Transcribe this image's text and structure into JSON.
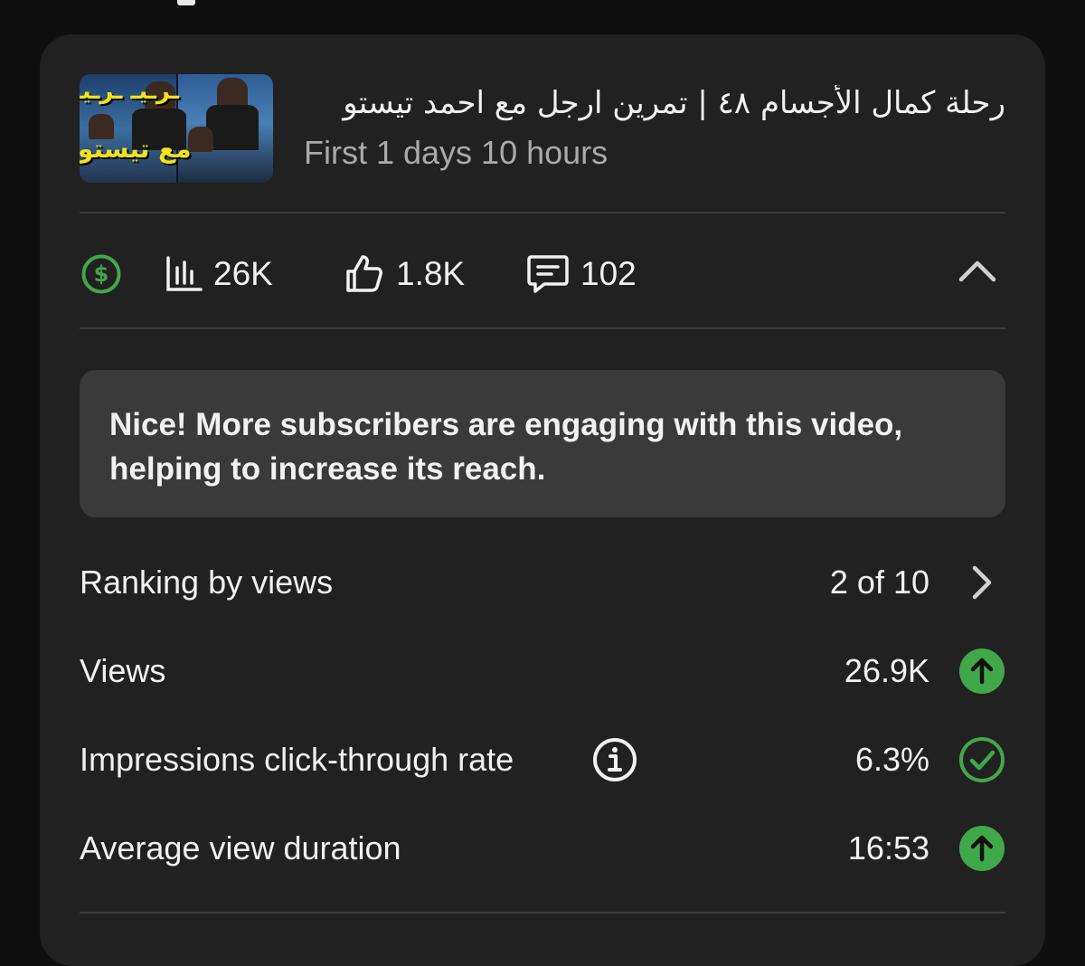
{
  "video": {
    "title": "رحلة كمال الأجسام ٤٨ | تمرين ارجل مع احمد تيستو",
    "subtitle": "First 1 days 10 hours",
    "thumbnail_text_top": "مع تيستو",
    "thumbnail_text_bottom": "مع تيستو"
  },
  "stats": {
    "monetization_icon": "dollar-circle-icon",
    "views": "26K",
    "likes": "1.8K",
    "comments": "102",
    "collapse_icon": "chevron-up-icon"
  },
  "tip": {
    "text": "Nice! More subscribers are engaging with this video, helping to increase its reach."
  },
  "metrics": [
    {
      "label": "Ranking by views",
      "value": "2 of 10",
      "indicator": "chevron-right-icon"
    },
    {
      "label": "Views",
      "value": "26.9K",
      "indicator": "arrow-up-icon"
    },
    {
      "label": "Impressions click-through rate",
      "value": "6.3%",
      "indicator": "check-circle-icon",
      "info_icon": "info-icon"
    },
    {
      "label": "Average view duration",
      "value": "16:53",
      "indicator": "arrow-up-icon"
    }
  ],
  "colors": {
    "background": "#0f0f0f",
    "card": "#212121",
    "tip_background": "#3a3a3a",
    "accent_green": "#41a84a",
    "text_primary": "#f1f1f1",
    "text_secondary": "#aaaaaa"
  }
}
